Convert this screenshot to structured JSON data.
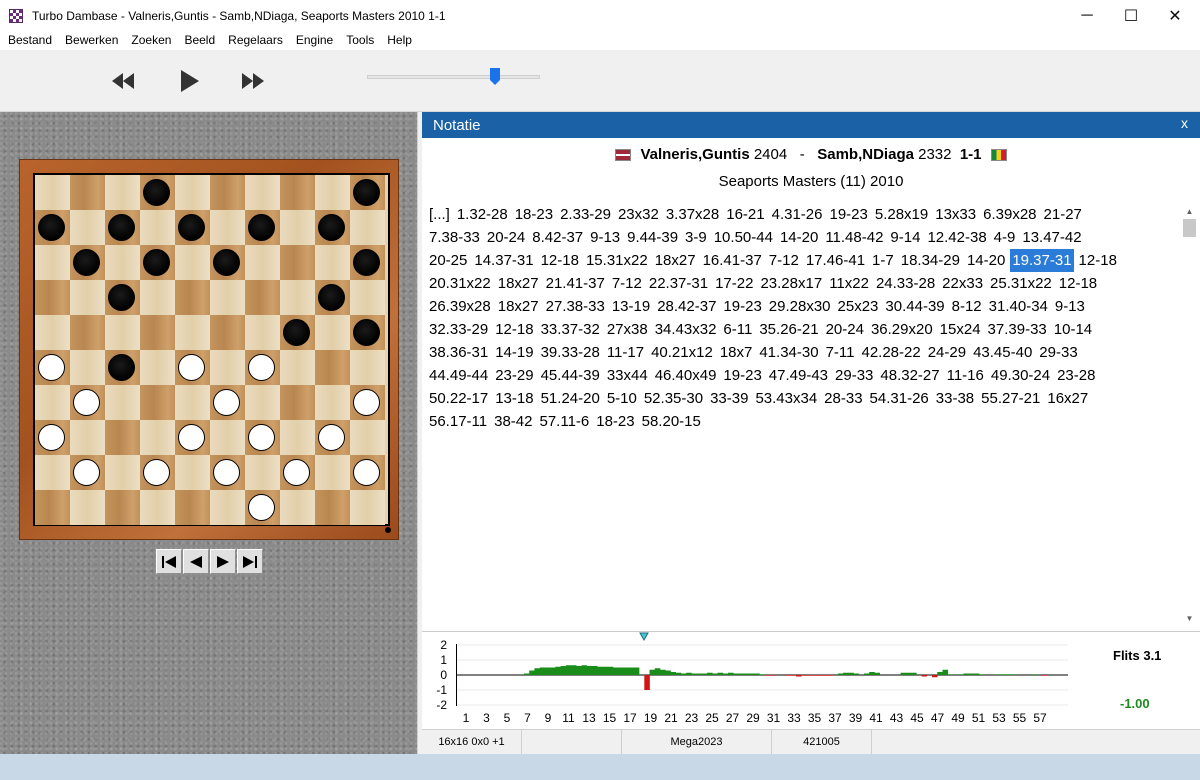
{
  "window": {
    "title": "Turbo Dambase - Valneris,Guntis - Samb,NDiaga, Seaports Masters 2010 1-1",
    "minimize": "─",
    "maximize": "☐",
    "close": "✕"
  },
  "menu": [
    "Bestand",
    "Bewerken",
    "Zoeken",
    "Beeld",
    "Regelaars",
    "Engine",
    "Tools",
    "Help"
  ],
  "toolbar": {
    "rewind_icon": "rewind-icon",
    "play_icon": "play-icon",
    "ffwd_icon": "fast-forward-icon",
    "speed_slider": 0.74
  },
  "board": {
    "size": 10,
    "black_pieces": [
      [
        0,
        3
      ],
      [
        0,
        9
      ],
      [
        1,
        0
      ],
      [
        1,
        2
      ],
      [
        1,
        4
      ],
      [
        1,
        6
      ],
      [
        1,
        8
      ],
      [
        2,
        1
      ],
      [
        2,
        3
      ],
      [
        2,
        5
      ],
      [
        2,
        9
      ],
      [
        3,
        2
      ],
      [
        3,
        8
      ],
      [
        4,
        7
      ],
      [
        4,
        9
      ],
      [
        5,
        2
      ]
    ],
    "white_pieces": [
      [
        5,
        0
      ],
      [
        5,
        4
      ],
      [
        5,
        6
      ],
      [
        6,
        1
      ],
      [
        6,
        5
      ],
      [
        6,
        9
      ],
      [
        7,
        0
      ],
      [
        7,
        4
      ],
      [
        7,
        6
      ],
      [
        7,
        8
      ],
      [
        8,
        1
      ],
      [
        8,
        3
      ],
      [
        8,
        5
      ],
      [
        8,
        7
      ],
      [
        8,
        9
      ],
      [
        9,
        6
      ]
    ],
    "nav": [
      "|◀",
      "◀",
      "▶",
      "▶|"
    ]
  },
  "notation": {
    "panel_title": "Notatie",
    "close": "x",
    "white_player": "Valneris,Guntis",
    "white_rating": "2404",
    "separator": "-",
    "black_player": "Samb,NDiaga",
    "black_rating": "2332",
    "result": "1-1",
    "event": "Seaports Masters (11) 2010",
    "lines": [
      [
        "[...]",
        "1.32-28",
        "18-23",
        "2.33-29",
        "23x32",
        "3.37x28",
        "16-21",
        "4.31-26",
        "19-23",
        "5.28x19",
        "13x33",
        "6.39x28",
        "21-27"
      ],
      [
        "7.38-33",
        "20-24",
        "8.42-37",
        "9-13",
        "9.44-39",
        "3-9",
        "10.50-44",
        "14-20",
        "11.48-42",
        "9-14",
        "12.42-38",
        "4-9",
        "13.47-42"
      ],
      [
        "20-25",
        "14.37-31",
        "12-18",
        "15.31x22",
        "18x27",
        "16.41-37",
        "7-12",
        "17.46-41",
        "1-7",
        "18.34-29",
        "14-20",
        "19.37-31",
        "12-18"
      ],
      [
        "20.31x22",
        "18x27",
        "21.41-37",
        "7-12",
        "22.37-31",
        "17-22",
        "23.28x17",
        "11x22",
        "24.33-28",
        "22x33",
        "25.31x22",
        "12-18"
      ],
      [
        "26.39x28",
        "18x27",
        "27.38-33",
        "13-19",
        "28.42-37",
        "19-23",
        "29.28x30",
        "25x23",
        "30.44-39",
        "8-12",
        "31.40-34",
        "9-13"
      ],
      [
        "32.33-29",
        "12-18",
        "33.37-32",
        "27x38",
        "34.43x32",
        "6-11",
        "35.26-21",
        "20-24",
        "36.29x20",
        "15x24",
        "37.39-33",
        "10-14"
      ],
      [
        "38.36-31",
        "14-19",
        "39.33-28",
        "11-17",
        "40.21x12",
        "18x7",
        "41.34-30",
        "7-11",
        "42.28-22",
        "24-29",
        "43.45-40",
        "29-33"
      ],
      [
        "44.49-44",
        "23-29",
        "45.44-39",
        "33x44",
        "46.40x49",
        "19-23",
        "47.49-43",
        "29-33",
        "48.32-27",
        "11-16",
        "49.30-24",
        "23-28"
      ],
      [
        "50.22-17",
        "13-18",
        "51.24-20",
        "5-10",
        "52.35-30",
        "33-39",
        "53.43x34",
        "28-33",
        "54.31-26",
        "33-38",
        "55.27-21",
        "16x27"
      ],
      [
        "56.17-11",
        "38-42",
        "57.11-6",
        "18-23",
        "58.20-15"
      ]
    ],
    "selected_move": "19.37-31"
  },
  "graph": {
    "y_ticks": [
      "2",
      "1",
      "0",
      "-1",
      "-2"
    ],
    "x_ticks": [
      "1",
      "3",
      "5",
      "7",
      "9",
      "11",
      "13",
      "15",
      "17",
      "19",
      "21",
      "23",
      "25",
      "27",
      "29",
      "31",
      "33",
      "35",
      "37",
      "39",
      "41",
      "43",
      "45",
      "47",
      "49",
      "51",
      "53",
      "55",
      "57"
    ],
    "engine": "Flits 3.1",
    "eval": "-1.00",
    "current_move": 18,
    "bars": [
      0,
      0,
      0,
      0,
      0,
      0,
      0,
      0,
      0,
      0,
      0,
      0,
      0,
      0.1,
      0.3,
      0.45,
      0.5,
      0.5,
      0.5,
      0.55,
      0.6,
      0.65,
      0.65,
      0.6,
      0.65,
      0.6,
      0.6,
      0.55,
      0.55,
      0.55,
      0.5,
      0.5,
      0.5,
      0.5,
      0.5,
      0,
      -1.0,
      0.35,
      0.45,
      0.35,
      0.3,
      0.2,
      0.15,
      0.1,
      0.15,
      0.1,
      0.1,
      0.1,
      0.15,
      0.1,
      0.15,
      0.1,
      0.15,
      0.1,
      0.1,
      0.1,
      0.1,
      0.1,
      0.05,
      -0.05,
      -0.05,
      0,
      0,
      -0.05,
      -0.05,
      -0.1,
      -0.05,
      -0.05,
      -0.05,
      -0.05,
      -0.05,
      -0.05,
      0,
      0.1,
      0.15,
      0.15,
      0.1,
      0,
      0.1,
      0.2,
      0.15,
      0,
      0,
      0,
      0,
      0.15,
      0.15,
      0.15,
      0,
      -0.1,
      0,
      -0.15,
      0.2,
      0.35,
      0.05,
      0,
      0.05,
      0.1,
      0.1,
      0.1,
      0.05,
      0,
      0,
      0.05,
      0.05,
      0.05,
      0.05,
      0,
      0,
      0,
      0.05,
      0,
      -0.05,
      0,
      0,
      0,
      0
    ],
    "colors": {
      "positive": "#1a8c1a",
      "negative": "#d21414"
    }
  },
  "statusbar": [
    "16x16 0x0 +1",
    "",
    "Mega2023",
    "421005"
  ]
}
